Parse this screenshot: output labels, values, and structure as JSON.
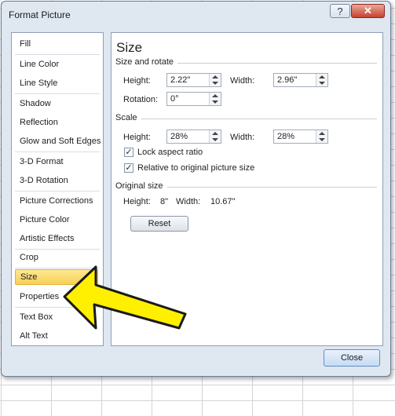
{
  "window": {
    "title": "Format Picture",
    "help_glyph": "?",
    "close_glyph": "✕"
  },
  "nav": {
    "items": [
      {
        "label": "Fill"
      },
      {
        "label": "Line Color"
      },
      {
        "label": "Line Style"
      },
      {
        "label": "Shadow"
      },
      {
        "label": "Reflection"
      },
      {
        "label": "Glow and Soft Edges"
      },
      {
        "label": "3-D Format"
      },
      {
        "label": "3-D Rotation"
      },
      {
        "label": "Picture Corrections"
      },
      {
        "label": "Picture Color"
      },
      {
        "label": "Artistic Effects"
      },
      {
        "label": "Crop"
      },
      {
        "label": "Size",
        "selected": true
      },
      {
        "label": "Properties"
      },
      {
        "label": "Text Box"
      },
      {
        "label": "Alt Text"
      }
    ]
  },
  "size_panel": {
    "title": "Size",
    "size_and_rotate": {
      "heading": "Size and rotate",
      "height_label": "Height:",
      "height_value": "2.22\"",
      "width_label": "Width:",
      "width_value": "2.96\"",
      "rotation_label": "Rotation:",
      "rotation_value": "0°"
    },
    "scale": {
      "heading": "Scale",
      "height_label": "Height:",
      "height_value": "28%",
      "width_label": "Width:",
      "width_value": "28%",
      "lock_aspect_label": "Lock aspect ratio",
      "lock_aspect_checked": true,
      "relative_label": "Relative to original picture size",
      "relative_checked": true
    },
    "original_size": {
      "heading": "Original size",
      "height_label": "Height:",
      "height_value": "8\"",
      "width_label": "Width:",
      "width_value": "10.67\""
    },
    "reset_label": "Reset"
  },
  "footer": {
    "close_label": "Close"
  },
  "colors": {
    "selected_bg": "#f7cf5a",
    "annotation_arrow": "#ffef00"
  }
}
